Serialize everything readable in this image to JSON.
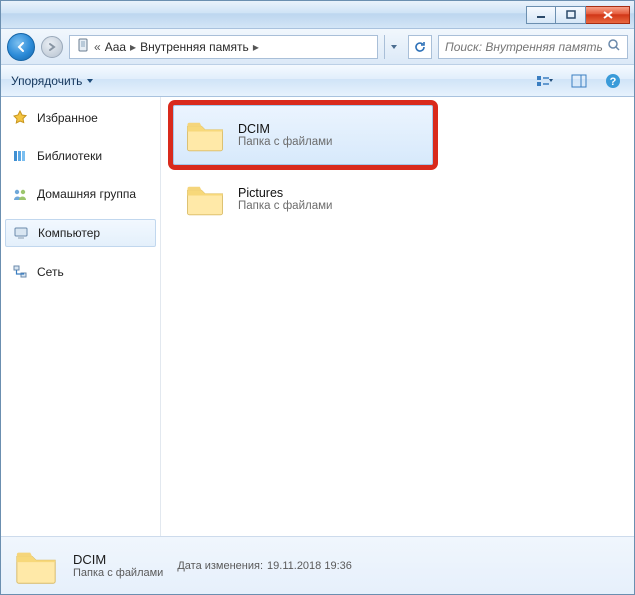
{
  "titlebar": {},
  "nav": {
    "breadcrumb": {
      "prefix": "«",
      "parts": [
        "Aaa",
        "Внутренняя память"
      ]
    },
    "search_placeholder": "Поиск: Внутренняя память"
  },
  "toolbar": {
    "organize_label": "Упорядочить"
  },
  "sidebar": {
    "items": [
      {
        "label": "Избранное",
        "icon": "star"
      },
      {
        "label": "Библиотеки",
        "icon": "libraries"
      },
      {
        "label": "Домашняя группа",
        "icon": "homegroup"
      },
      {
        "label": "Компьютер",
        "icon": "computer",
        "selected": true
      },
      {
        "label": "Сеть",
        "icon": "network"
      }
    ]
  },
  "content": {
    "items": [
      {
        "name": "DCIM",
        "desc": "Папка с файлами",
        "selected": true,
        "highlighted": true
      },
      {
        "name": "Pictures",
        "desc": "Папка с файлами"
      }
    ]
  },
  "status": {
    "name": "DCIM",
    "desc": "Папка с файлами",
    "meta_label": "Дата изменения:",
    "meta_value": "19.11.2018 19:36"
  }
}
